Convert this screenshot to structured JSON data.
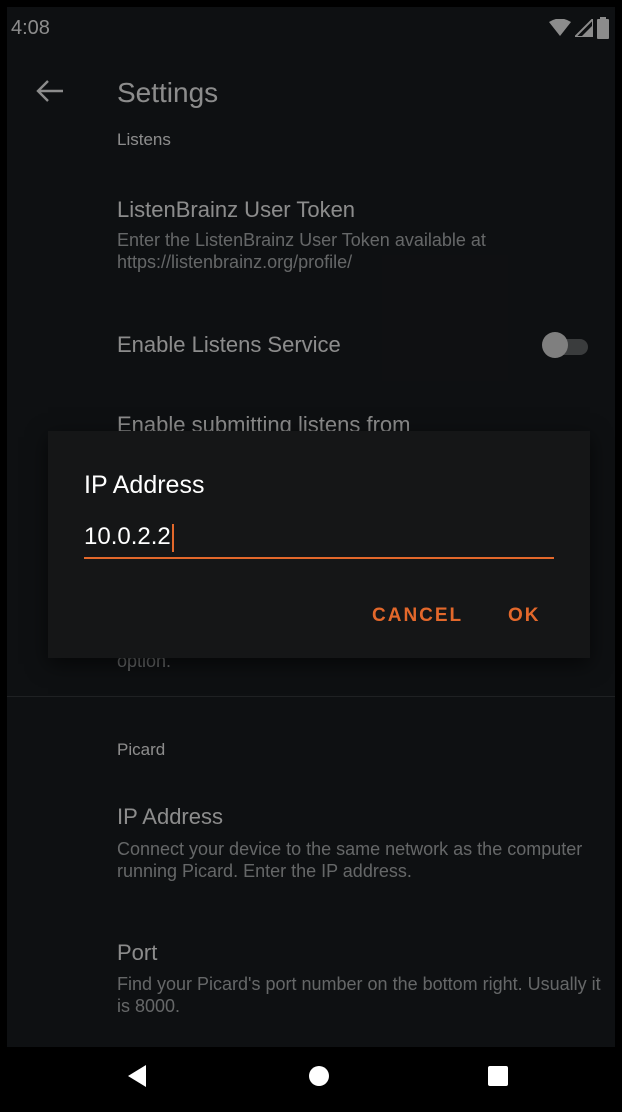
{
  "status_bar": {
    "time": "4:08",
    "icons": [
      "wifi-icon",
      "signal-icon",
      "battery-icon"
    ]
  },
  "app_bar": {
    "title": "Settings",
    "back_icon": "arrow-back-icon"
  },
  "listens": {
    "category": "Listens",
    "user_token": {
      "title": "ListenBrainz User Token",
      "summary": "Enter the ListenBrainz User Token available at https://listenbrainz.org/profile/"
    },
    "enable_service": {
      "title": "Enable Listens Service",
      "enabled": false
    },
    "submitting_from": {
      "title": "Enable submitting listens from",
      "summary_tail": "option."
    }
  },
  "picard": {
    "category": "Picard",
    "ip_address": {
      "title": "IP Address",
      "summary": "Connect your device to the same network as the computer running Picard. Enter the IP address."
    },
    "port": {
      "title": "Port",
      "summary": "Find your Picard's port number on the bottom right. Usually it is 8000."
    }
  },
  "dialog": {
    "title": "IP Address",
    "input_value": "10.0.2.2",
    "cancel_label": "CANCEL",
    "ok_label": "OK"
  },
  "nav_bar": {
    "icons": [
      "back-triangle-icon",
      "home-circle-icon",
      "recents-square-icon"
    ]
  },
  "colors": {
    "accent": "#e3682b",
    "background": "#1b1e21",
    "dialog": "#151617"
  }
}
